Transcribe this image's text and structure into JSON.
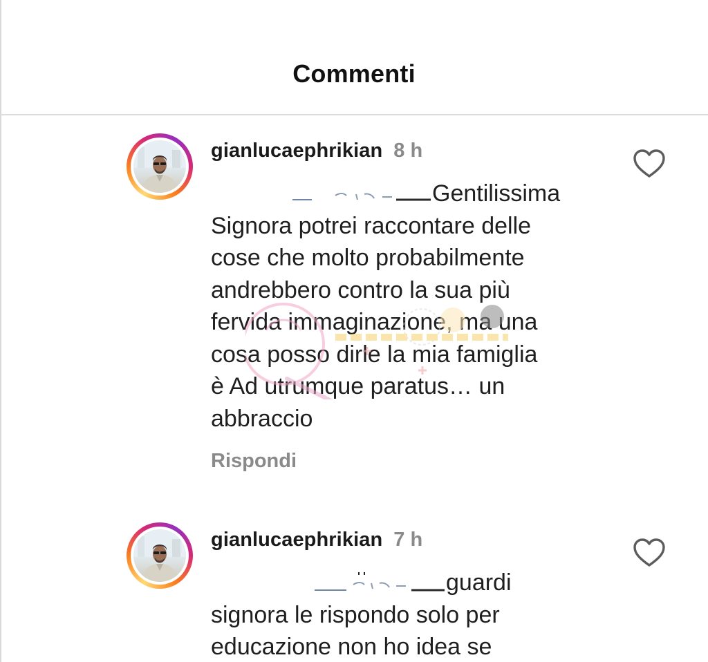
{
  "header": {
    "title": "Commenti"
  },
  "comments": [
    {
      "username": "gianlucaephrikian",
      "time": "8 h",
      "text": "Gentilissima\nSignora potrei raccontare delle\ncose che molto probabilmente\nandrebbero contro la sua più\nfervida immaginazione, ma una\ncosa posso dirle la mia famiglia\nè Ad utrumque paratus… un\nabbraccio",
      "reply_label": "Rispondi",
      "like_icon": "heart-outline-icon"
    },
    {
      "username": "gianlucaephrikian",
      "time": "7 h",
      "text": "guardi\nsignora le rispondo solo per\neducazione non ho idea se",
      "like_icon": "heart-outline-icon"
    }
  ],
  "colors": {
    "story_ring_start": "#feda75",
    "story_ring_end": "#d62976",
    "muted_text": "#8a8a8a",
    "divider": "#dcdcdc"
  }
}
